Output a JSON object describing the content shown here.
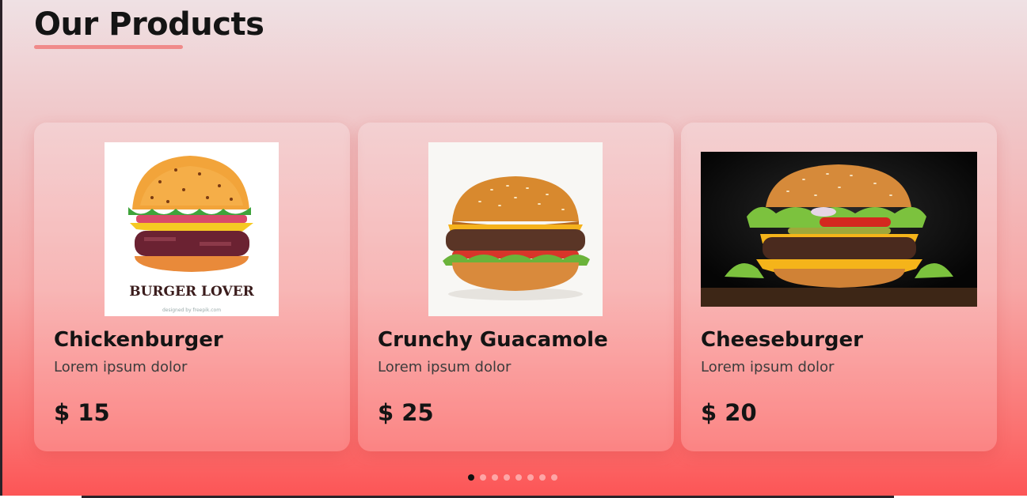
{
  "section": {
    "title": "Our Products"
  },
  "products": [
    {
      "name": "Chickenburger",
      "description": "Lorem ipsum dolor",
      "price": "$ 15",
      "image_text": "Burger Lover",
      "image_credit": "designed by freepik.com",
      "image": "illustrated-burger-icon"
    },
    {
      "name": "Crunchy Guacamole",
      "description": "Lorem ipsum dolor",
      "price": "$ 25",
      "image": "cheeseburger-photo-white-bg"
    },
    {
      "name": "Cheeseburger",
      "description": "Lorem ipsum dolor",
      "price": "$ 20",
      "image": "cheeseburger-photo-dark-bg"
    }
  ],
  "carousel": {
    "dot_count": 8,
    "active_index": 0
  },
  "colors": {
    "accent": "#f08a8a",
    "text": "#141414",
    "bg_bottom": "#fc5556"
  }
}
